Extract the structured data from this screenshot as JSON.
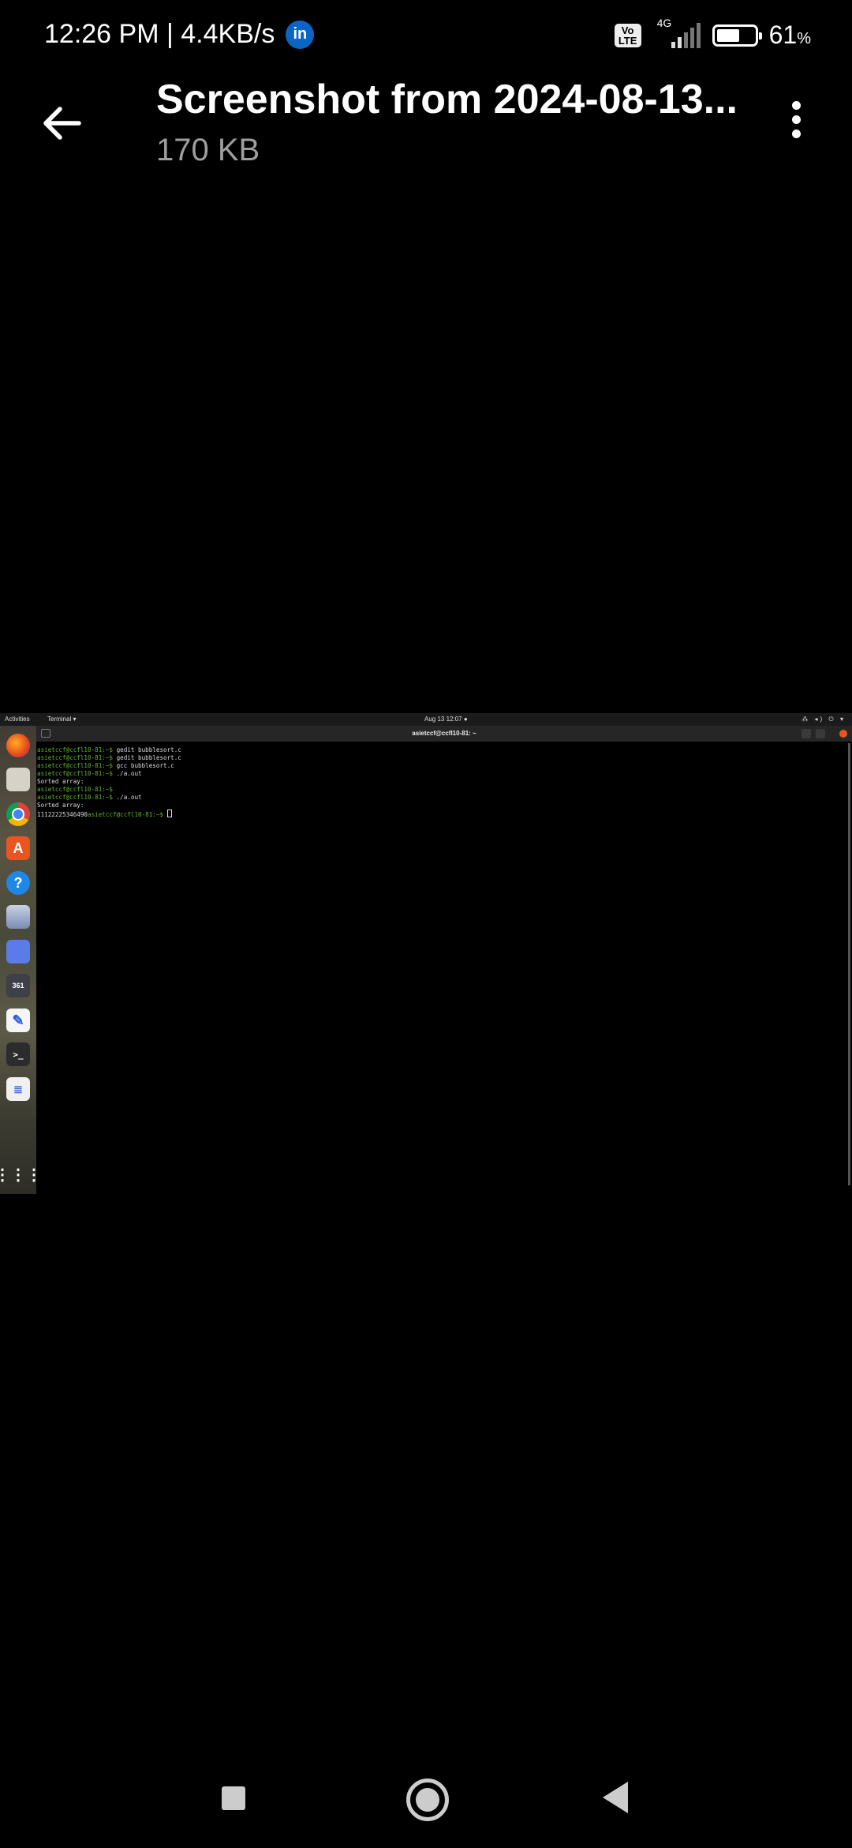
{
  "status_bar": {
    "time_speed": "12:26 PM | 4.4KB/s",
    "linkedin_badge": "in",
    "volte": "Vo\nLTE",
    "network": "4G",
    "battery_percent": "61",
    "battery_unit": "%",
    "battery_level": 0.61
  },
  "header": {
    "title": "Screenshot from 2024-08-13...",
    "subtitle": "170 KB",
    "back_icon": "arrow-left-icon",
    "more_icon": "more-vertical-icon"
  },
  "embedded": {
    "topbar": {
      "activities": "Activities",
      "app_menu": "Terminal ▾",
      "clock": "Aug 13  12:07  ●",
      "tray": "⁂ ◂) ⏻ ▾"
    },
    "terminal": {
      "title": "asietccf@ccfl10-81: ~",
      "lines": [
        {
          "prompt": "asietccf@ccfl10-81:~$",
          "text": " gedit bubblesort.c"
        },
        {
          "prompt": "asietccf@ccfl10-81:~$",
          "text": " gedit bubblesort.c"
        },
        {
          "prompt": "asietccf@ccfl10-81:~$",
          "text": " gcc bubblesort.c"
        },
        {
          "prompt": "asietccf@ccfl10-81:~$",
          "text": " ./a.out"
        },
        {
          "prompt": "",
          "text": "Sorted array:"
        },
        {
          "prompt": "asietccf@ccfl10-81:~$",
          "text": ""
        },
        {
          "prompt": "asietccf@ccfl10-81:~$",
          "text": " ./a.out"
        },
        {
          "prompt": "",
          "text": "Sorted array:"
        }
      ],
      "last_output": "11122225346490",
      "last_prompt": "asietccf@ccfl10-81:~$"
    },
    "dock_icons": [
      "firefox-icon",
      "files-icon",
      "chrome-icon",
      "app-center-icon",
      "help-icon",
      "database-icon",
      "screenshot-icon",
      "terminal-tile-icon",
      "text-editor-icon",
      "terminal-icon",
      "document-viewer-icon",
      "app-grid-icon"
    ]
  },
  "nav_bar": {
    "recent_icon": "recent-apps-icon",
    "home_icon": "home-icon",
    "back_icon": "nav-back-icon"
  },
  "colors": {
    "background": "#000000",
    "subtitle": "#9e9e9e",
    "prompt_green": "#5fb336",
    "ubuntu_orange": "#e95420",
    "linkedin_blue": "#0a66c2"
  }
}
